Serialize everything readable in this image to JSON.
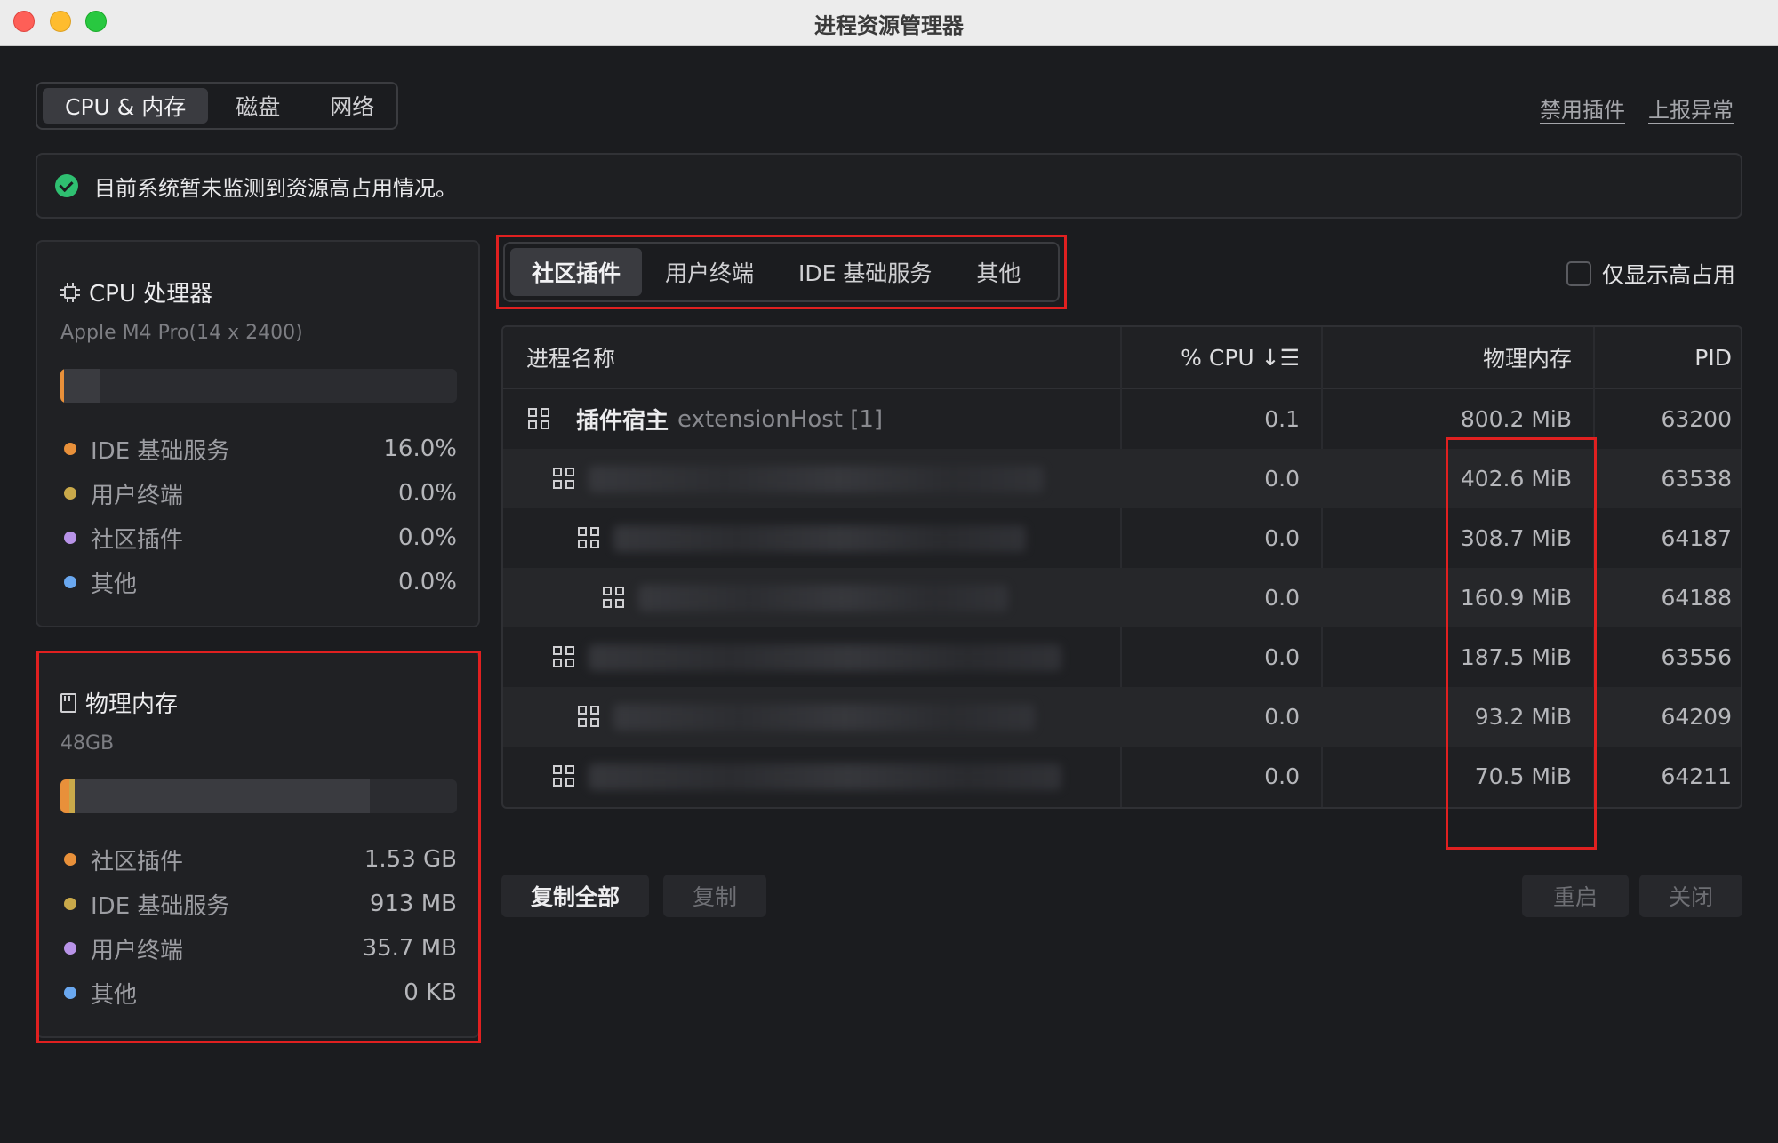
{
  "window": {
    "title": "进程资源管理器"
  },
  "top_tabs": [
    {
      "label": "CPU & 内存",
      "active": true
    },
    {
      "label": "磁盘",
      "active": false
    },
    {
      "label": "网络",
      "active": false
    }
  ],
  "top_links": {
    "disable_plugins": "禁用插件",
    "report_issue": "上报异常"
  },
  "banner": {
    "text": "目前系统暂未监测到资源高占用情况。",
    "status_color": "#2fbf71"
  },
  "cpu_panel": {
    "title": "CPU 处理器",
    "subtitle": "Apple M4 Pro(14 x 2400)",
    "usage_fraction": 0.02,
    "legend": [
      {
        "label": "IDE 基础服务",
        "value": "16.0%",
        "color": "#e8903a"
      },
      {
        "label": "用户终端",
        "value": "0.0%",
        "color": "#c9a94a"
      },
      {
        "label": "社区插件",
        "value": "0.0%",
        "color": "#b893e8"
      },
      {
        "label": "其他",
        "value": "0.0%",
        "color": "#6aa8f0"
      }
    ]
  },
  "mem_panel": {
    "title": "物理内存",
    "subtitle": "48GB",
    "usage_fraction": 0.78,
    "legend": [
      {
        "label": "社区插件",
        "value": "1.53 GB",
        "color": "#e8903a"
      },
      {
        "label": "IDE 基础服务",
        "value": "913 MB",
        "color": "#c9a94a"
      },
      {
        "label": "用户终端",
        "value": "35.7 MB",
        "color": "#b893e8"
      },
      {
        "label": "其他",
        "value": "0 KB",
        "color": "#6aa8f0"
      }
    ]
  },
  "category_tabs": [
    {
      "label": "社区插件",
      "active": true
    },
    {
      "label": "用户终端",
      "active": false
    },
    {
      "label": "IDE 基础服务",
      "active": false
    },
    {
      "label": "其他",
      "active": false
    }
  ],
  "filter": {
    "label": "仅显示高占用",
    "checked": false
  },
  "table": {
    "headers": {
      "name": "进程名称",
      "cpu": "% CPU ↓☰",
      "memory": "物理内存",
      "pid": "PID"
    },
    "rows": [
      {
        "name": "插件宿主",
        "detail": "extensionHost [1]",
        "cpu": "0.1",
        "memory": "800.2 MiB",
        "pid": "63200",
        "depth": 0
      },
      {
        "name": "",
        "detail": "",
        "cpu": "0.0",
        "memory": "402.6 MiB",
        "pid": "63538",
        "depth": 1
      },
      {
        "name": "",
        "detail": "",
        "cpu": "0.0",
        "memory": "308.7 MiB",
        "pid": "64187",
        "depth": 2
      },
      {
        "name": "",
        "detail": "",
        "cpu": "0.0",
        "memory": "160.9 MiB",
        "pid": "64188",
        "depth": 3
      },
      {
        "name": "",
        "detail": "",
        "cpu": "0.0",
        "memory": "187.5 MiB",
        "pid": "63556",
        "depth": 1
      },
      {
        "name": "",
        "detail": "",
        "cpu": "0.0",
        "memory": "93.2 MiB",
        "pid": "64209",
        "depth": 2
      },
      {
        "name": "",
        "detail": "",
        "cpu": "0.0",
        "memory": "70.5 MiB",
        "pid": "64211",
        "depth": 1
      }
    ]
  },
  "actions": {
    "copy_all": "复制全部",
    "copy": "复制",
    "restart": "重启",
    "close": "关闭"
  }
}
